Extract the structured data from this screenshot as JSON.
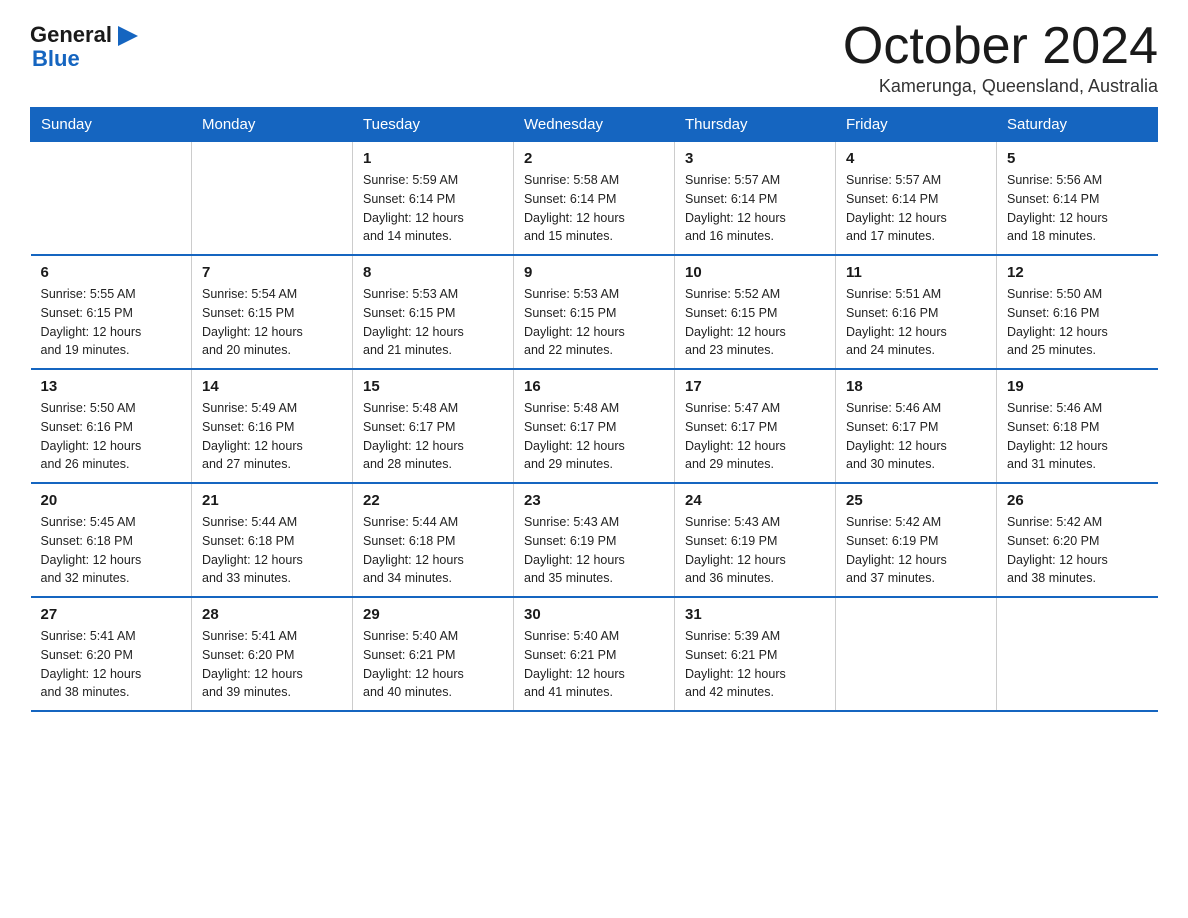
{
  "logo": {
    "text_general": "General",
    "text_blue": "Blue",
    "icon": "▶"
  },
  "header": {
    "month_title": "October 2024",
    "location": "Kamerunga, Queensland, Australia"
  },
  "days_of_week": [
    "Sunday",
    "Monday",
    "Tuesday",
    "Wednesday",
    "Thursday",
    "Friday",
    "Saturday"
  ],
  "weeks": [
    [
      {
        "day": "",
        "info": ""
      },
      {
        "day": "",
        "info": ""
      },
      {
        "day": "1",
        "info": "Sunrise: 5:59 AM\nSunset: 6:14 PM\nDaylight: 12 hours\nand 14 minutes."
      },
      {
        "day": "2",
        "info": "Sunrise: 5:58 AM\nSunset: 6:14 PM\nDaylight: 12 hours\nand 15 minutes."
      },
      {
        "day": "3",
        "info": "Sunrise: 5:57 AM\nSunset: 6:14 PM\nDaylight: 12 hours\nand 16 minutes."
      },
      {
        "day": "4",
        "info": "Sunrise: 5:57 AM\nSunset: 6:14 PM\nDaylight: 12 hours\nand 17 minutes."
      },
      {
        "day": "5",
        "info": "Sunrise: 5:56 AM\nSunset: 6:14 PM\nDaylight: 12 hours\nand 18 minutes."
      }
    ],
    [
      {
        "day": "6",
        "info": "Sunrise: 5:55 AM\nSunset: 6:15 PM\nDaylight: 12 hours\nand 19 minutes."
      },
      {
        "day": "7",
        "info": "Sunrise: 5:54 AM\nSunset: 6:15 PM\nDaylight: 12 hours\nand 20 minutes."
      },
      {
        "day": "8",
        "info": "Sunrise: 5:53 AM\nSunset: 6:15 PM\nDaylight: 12 hours\nand 21 minutes."
      },
      {
        "day": "9",
        "info": "Sunrise: 5:53 AM\nSunset: 6:15 PM\nDaylight: 12 hours\nand 22 minutes."
      },
      {
        "day": "10",
        "info": "Sunrise: 5:52 AM\nSunset: 6:15 PM\nDaylight: 12 hours\nand 23 minutes."
      },
      {
        "day": "11",
        "info": "Sunrise: 5:51 AM\nSunset: 6:16 PM\nDaylight: 12 hours\nand 24 minutes."
      },
      {
        "day": "12",
        "info": "Sunrise: 5:50 AM\nSunset: 6:16 PM\nDaylight: 12 hours\nand 25 minutes."
      }
    ],
    [
      {
        "day": "13",
        "info": "Sunrise: 5:50 AM\nSunset: 6:16 PM\nDaylight: 12 hours\nand 26 minutes."
      },
      {
        "day": "14",
        "info": "Sunrise: 5:49 AM\nSunset: 6:16 PM\nDaylight: 12 hours\nand 27 minutes."
      },
      {
        "day": "15",
        "info": "Sunrise: 5:48 AM\nSunset: 6:17 PM\nDaylight: 12 hours\nand 28 minutes."
      },
      {
        "day": "16",
        "info": "Sunrise: 5:48 AM\nSunset: 6:17 PM\nDaylight: 12 hours\nand 29 minutes."
      },
      {
        "day": "17",
        "info": "Sunrise: 5:47 AM\nSunset: 6:17 PM\nDaylight: 12 hours\nand 29 minutes."
      },
      {
        "day": "18",
        "info": "Sunrise: 5:46 AM\nSunset: 6:17 PM\nDaylight: 12 hours\nand 30 minutes."
      },
      {
        "day": "19",
        "info": "Sunrise: 5:46 AM\nSunset: 6:18 PM\nDaylight: 12 hours\nand 31 minutes."
      }
    ],
    [
      {
        "day": "20",
        "info": "Sunrise: 5:45 AM\nSunset: 6:18 PM\nDaylight: 12 hours\nand 32 minutes."
      },
      {
        "day": "21",
        "info": "Sunrise: 5:44 AM\nSunset: 6:18 PM\nDaylight: 12 hours\nand 33 minutes."
      },
      {
        "day": "22",
        "info": "Sunrise: 5:44 AM\nSunset: 6:18 PM\nDaylight: 12 hours\nand 34 minutes."
      },
      {
        "day": "23",
        "info": "Sunrise: 5:43 AM\nSunset: 6:19 PM\nDaylight: 12 hours\nand 35 minutes."
      },
      {
        "day": "24",
        "info": "Sunrise: 5:43 AM\nSunset: 6:19 PM\nDaylight: 12 hours\nand 36 minutes."
      },
      {
        "day": "25",
        "info": "Sunrise: 5:42 AM\nSunset: 6:19 PM\nDaylight: 12 hours\nand 37 minutes."
      },
      {
        "day": "26",
        "info": "Sunrise: 5:42 AM\nSunset: 6:20 PM\nDaylight: 12 hours\nand 38 minutes."
      }
    ],
    [
      {
        "day": "27",
        "info": "Sunrise: 5:41 AM\nSunset: 6:20 PM\nDaylight: 12 hours\nand 38 minutes."
      },
      {
        "day": "28",
        "info": "Sunrise: 5:41 AM\nSunset: 6:20 PM\nDaylight: 12 hours\nand 39 minutes."
      },
      {
        "day": "29",
        "info": "Sunrise: 5:40 AM\nSunset: 6:21 PM\nDaylight: 12 hours\nand 40 minutes."
      },
      {
        "day": "30",
        "info": "Sunrise: 5:40 AM\nSunset: 6:21 PM\nDaylight: 12 hours\nand 41 minutes."
      },
      {
        "day": "31",
        "info": "Sunrise: 5:39 AM\nSunset: 6:21 PM\nDaylight: 12 hours\nand 42 minutes."
      },
      {
        "day": "",
        "info": ""
      },
      {
        "day": "",
        "info": ""
      }
    ]
  ]
}
